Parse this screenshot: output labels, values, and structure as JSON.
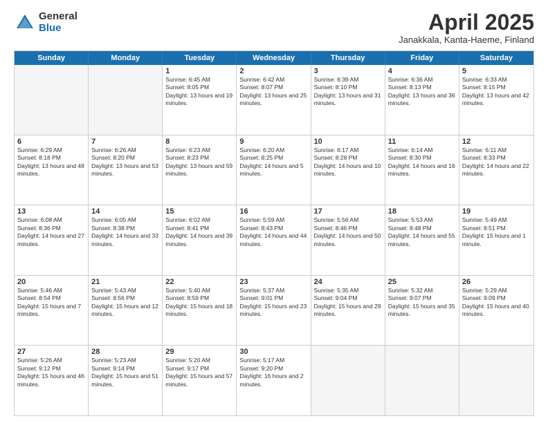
{
  "header": {
    "logo_general": "General",
    "logo_blue": "Blue",
    "month_title": "April 2025",
    "location": "Janakkala, Kanta-Haeme, Finland"
  },
  "weekdays": [
    "Sunday",
    "Monday",
    "Tuesday",
    "Wednesday",
    "Thursday",
    "Friday",
    "Saturday"
  ],
  "rows": [
    [
      {
        "day": "",
        "info": ""
      },
      {
        "day": "",
        "info": ""
      },
      {
        "day": "1",
        "info": "Sunrise: 6:45 AM\nSunset: 8:05 PM\nDaylight: 13 hours and 19 minutes."
      },
      {
        "day": "2",
        "info": "Sunrise: 6:42 AM\nSunset: 8:07 PM\nDaylight: 13 hours and 25 minutes."
      },
      {
        "day": "3",
        "info": "Sunrise: 6:39 AM\nSunset: 8:10 PM\nDaylight: 13 hours and 31 minutes."
      },
      {
        "day": "4",
        "info": "Sunrise: 6:36 AM\nSunset: 8:13 PM\nDaylight: 13 hours and 36 minutes."
      },
      {
        "day": "5",
        "info": "Sunrise: 6:33 AM\nSunset: 8:15 PM\nDaylight: 13 hours and 42 minutes."
      }
    ],
    [
      {
        "day": "6",
        "info": "Sunrise: 6:29 AM\nSunset: 8:18 PM\nDaylight: 13 hours and 48 minutes."
      },
      {
        "day": "7",
        "info": "Sunrise: 6:26 AM\nSunset: 8:20 PM\nDaylight: 13 hours and 53 minutes."
      },
      {
        "day": "8",
        "info": "Sunrise: 6:23 AM\nSunset: 8:23 PM\nDaylight: 13 hours and 59 minutes."
      },
      {
        "day": "9",
        "info": "Sunrise: 6:20 AM\nSunset: 8:25 PM\nDaylight: 14 hours and 5 minutes."
      },
      {
        "day": "10",
        "info": "Sunrise: 6:17 AM\nSunset: 8:28 PM\nDaylight: 14 hours and 10 minutes."
      },
      {
        "day": "11",
        "info": "Sunrise: 6:14 AM\nSunset: 8:30 PM\nDaylight: 14 hours and 16 minutes."
      },
      {
        "day": "12",
        "info": "Sunrise: 6:11 AM\nSunset: 8:33 PM\nDaylight: 14 hours and 22 minutes."
      }
    ],
    [
      {
        "day": "13",
        "info": "Sunrise: 6:08 AM\nSunset: 8:36 PM\nDaylight: 14 hours and 27 minutes."
      },
      {
        "day": "14",
        "info": "Sunrise: 6:05 AM\nSunset: 8:38 PM\nDaylight: 14 hours and 33 minutes."
      },
      {
        "day": "15",
        "info": "Sunrise: 6:02 AM\nSunset: 8:41 PM\nDaylight: 14 hours and 39 minutes."
      },
      {
        "day": "16",
        "info": "Sunrise: 5:59 AM\nSunset: 8:43 PM\nDaylight: 14 hours and 44 minutes."
      },
      {
        "day": "17",
        "info": "Sunrise: 5:56 AM\nSunset: 8:46 PM\nDaylight: 14 hours and 50 minutes."
      },
      {
        "day": "18",
        "info": "Sunrise: 5:53 AM\nSunset: 8:48 PM\nDaylight: 14 hours and 55 minutes."
      },
      {
        "day": "19",
        "info": "Sunrise: 5:49 AM\nSunset: 8:51 PM\nDaylight: 15 hours and 1 minute."
      }
    ],
    [
      {
        "day": "20",
        "info": "Sunrise: 5:46 AM\nSunset: 8:54 PM\nDaylight: 15 hours and 7 minutes."
      },
      {
        "day": "21",
        "info": "Sunrise: 5:43 AM\nSunset: 8:56 PM\nDaylight: 15 hours and 12 minutes."
      },
      {
        "day": "22",
        "info": "Sunrise: 5:40 AM\nSunset: 8:59 PM\nDaylight: 15 hours and 18 minutes."
      },
      {
        "day": "23",
        "info": "Sunrise: 5:37 AM\nSunset: 9:01 PM\nDaylight: 15 hours and 23 minutes."
      },
      {
        "day": "24",
        "info": "Sunrise: 5:35 AM\nSunset: 9:04 PM\nDaylight: 15 hours and 29 minutes."
      },
      {
        "day": "25",
        "info": "Sunrise: 5:32 AM\nSunset: 9:07 PM\nDaylight: 15 hours and 35 minutes."
      },
      {
        "day": "26",
        "info": "Sunrise: 5:29 AM\nSunset: 9:09 PM\nDaylight: 15 hours and 40 minutes."
      }
    ],
    [
      {
        "day": "27",
        "info": "Sunrise: 5:26 AM\nSunset: 9:12 PM\nDaylight: 15 hours and 46 minutes."
      },
      {
        "day": "28",
        "info": "Sunrise: 5:23 AM\nSunset: 9:14 PM\nDaylight: 15 hours and 51 minutes."
      },
      {
        "day": "29",
        "info": "Sunrise: 5:20 AM\nSunset: 9:17 PM\nDaylight: 15 hours and 57 minutes."
      },
      {
        "day": "30",
        "info": "Sunrise: 5:17 AM\nSunset: 9:20 PM\nDaylight: 16 hours and 2 minutes."
      },
      {
        "day": "",
        "info": ""
      },
      {
        "day": "",
        "info": ""
      },
      {
        "day": "",
        "info": ""
      }
    ]
  ]
}
